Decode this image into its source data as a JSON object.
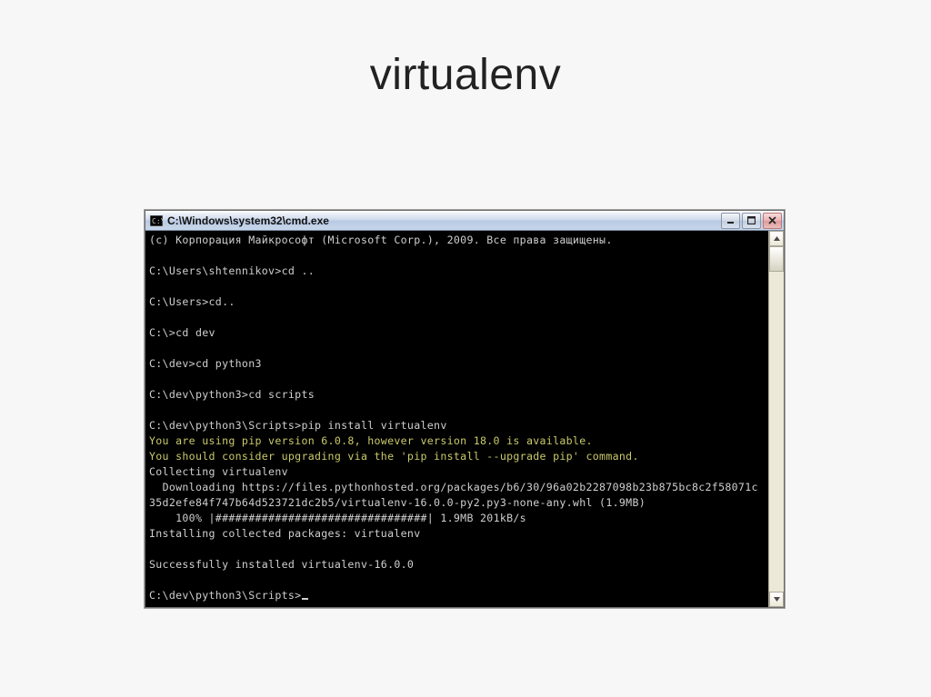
{
  "slide": {
    "title": "virtualenv"
  },
  "window": {
    "icon_name": "cmd-icon",
    "title": "C:\\Windows\\system32\\cmd.exe",
    "buttons": {
      "minimize": "_",
      "maximize": "□",
      "close": "×"
    }
  },
  "terminal": {
    "copyright": "(c) Корпорация Майкрософт (Microsoft Corp.), 2009. Все права защищены.",
    "blank": "",
    "p1": "C:\\Users\\shtennikov>cd ..",
    "p2": "C:\\Users>cd..",
    "p3": "C:\\>cd dev",
    "p4": "C:\\dev>cd python3",
    "p5": "C:\\dev\\python3>cd scripts",
    "p6": "C:\\dev\\python3\\Scripts>pip install virtualenv",
    "warn1": "You are using pip version 6.0.8, however version 18.0 is available.",
    "warn2": "You should consider upgrading via the 'pip install --upgrade pip' command.",
    "collect": "Collecting virtualenv",
    "download": "  Downloading https://files.pythonhosted.org/packages/b6/30/96a02b2287098b23b875bc8c2f58071c35d2efe84f747b64d523721dc2b5/virtualenv-16.0.0-py2.py3-none-any.whl (1.9MB)",
    "progress": "    100% |################################| 1.9MB 201kB/s",
    "installing": "Installing collected packages: virtualenv",
    "success": "Successfully installed virtualenv-16.0.0",
    "final_prompt": "C:\\dev\\python3\\Scripts>"
  }
}
